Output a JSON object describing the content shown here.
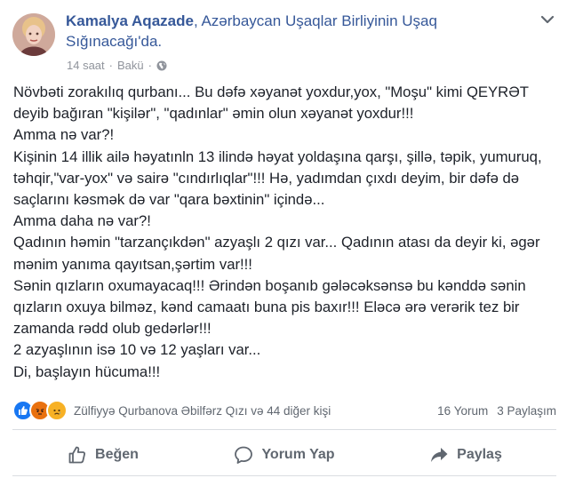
{
  "header": {
    "author": "Kamalya Aqazade",
    "location_text": ", Azərbaycan Uşaqlar Birliyinin Uşaq Sığınacağı'da.",
    "time": "14 saat",
    "place": "Bakü",
    "separator": "·"
  },
  "post": {
    "lines": [
      "Növbəti zorakılıq qurbanı... Bu dəfə xəyanət yoxdur,yox, \"Moşu\" kimi QEYRƏT deyib bağıran \"kişilər\", \"qadınlar\" əmin olun xəyanət yoxdur!!!",
      "Amma nə var?!",
      "Kişinin 14 illik ailə həyatınln 13 ilində həyat yoldaşına qarşı, şillə, təpik, yumuruq, təhqir,\"var-yox\" və sairə \"cındırlıqlar\"!!! Hə, yadımdan çıxdı deyim, bir dəfə də saçlarını kəsmək də var \"qara bəxtinin\" içində...",
      "Amma daha nə var?!",
      "Qadının həmin \"tarzançıkdən\" azyaşlı 2 qızı var... Qadının atası da deyir ki, əgər mənim yanıma qayıtsan,şərtim var!!!",
      "Sənin qızların oxumayacaq!!! Ərindən boşanıb gələcəksənsə bu kənddə sənin qızların oxuya bilməz, kənd camaatı buna pis baxır!!! Eləcə ərə verərik tez bir zamanda rədd olub gedərlər!!!",
      "2 azyaşlının isə 10 və 12 yaşları var...",
      "Di, başlayın hücuma!!!"
    ]
  },
  "reactions": {
    "names": "Zülfiyyə Qurbanova Əbilfərz Qızı və 44 diğer kişi",
    "comments": "16 Yorum",
    "shares": "3 Paylaşım",
    "icons": [
      "like-icon",
      "angry-icon",
      "sad-icon"
    ],
    "colors": {
      "like": "#1877f2",
      "angry": "#e9710f",
      "sad": "#f7b125"
    }
  },
  "actions": {
    "like": "Beğen",
    "comment": "Yorum Yap",
    "share": "Paylaş"
  },
  "colors": {
    "link": "#365899",
    "text": "#1d2129",
    "muted": "#606770",
    "divider": "#dadde1"
  }
}
